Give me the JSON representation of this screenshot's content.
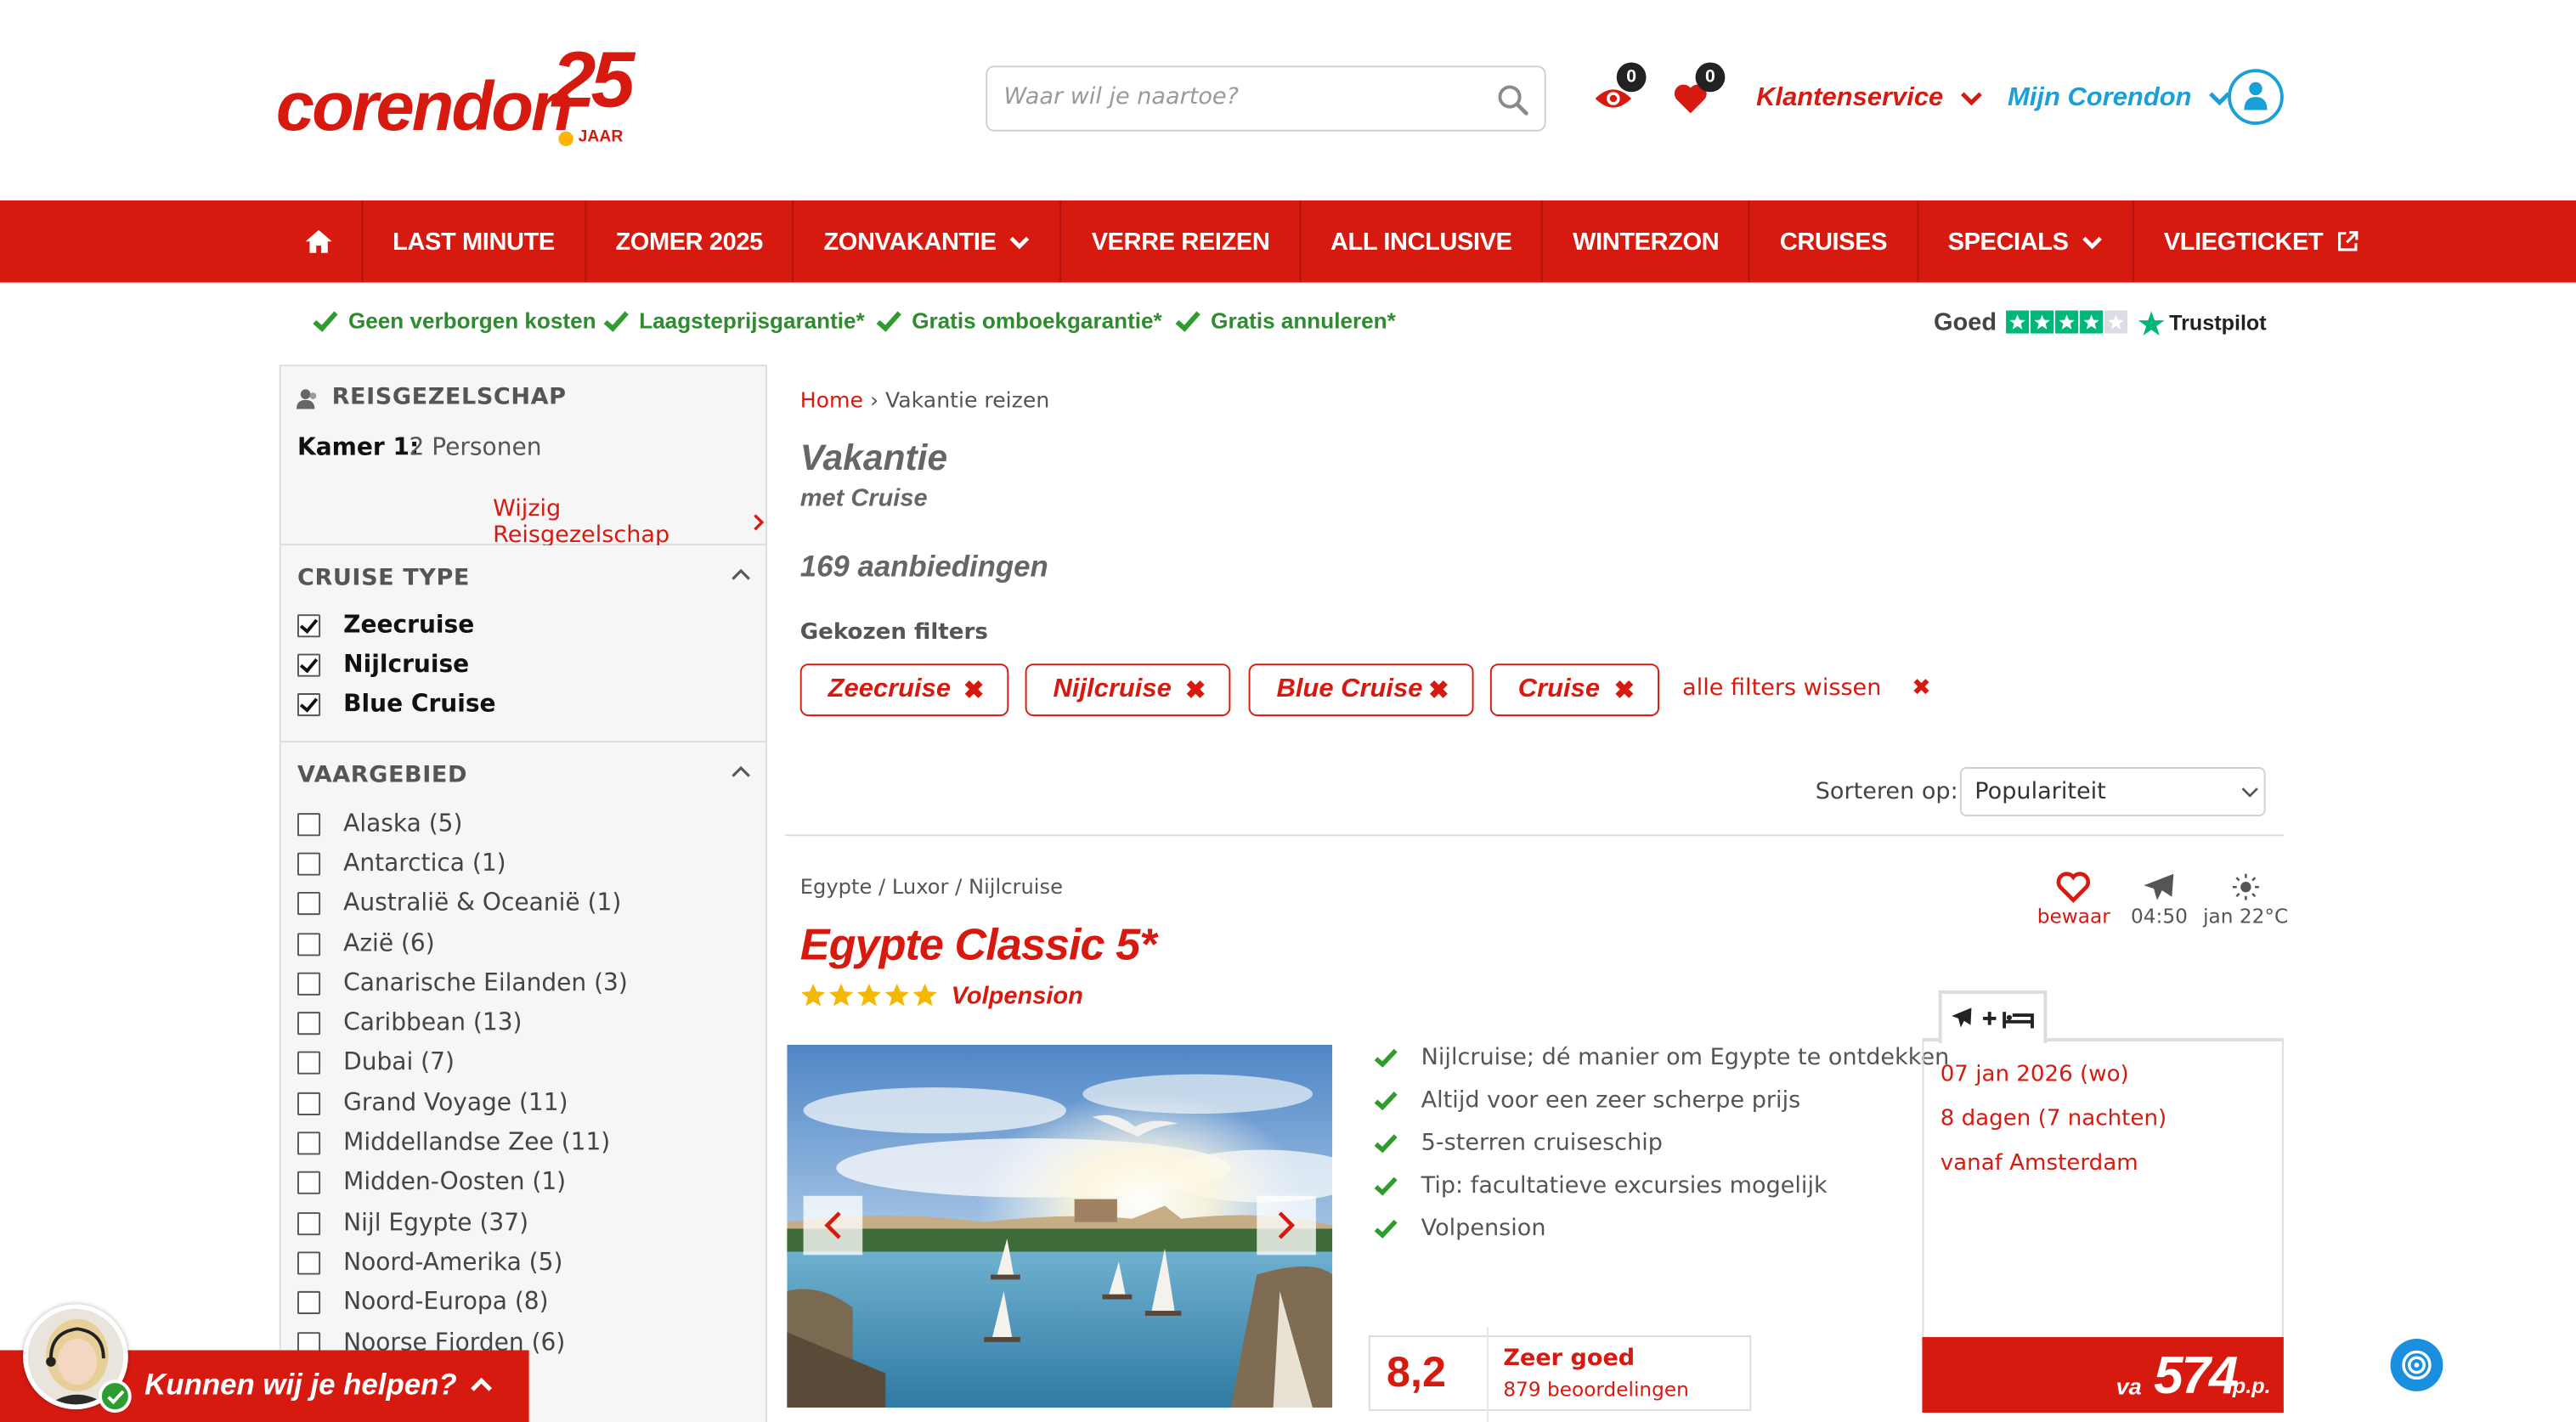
{
  "header": {
    "logo_text": "corendon",
    "logo_anniversary": "25",
    "logo_jaar": "JAAR",
    "search_placeholder": "Waar wil je naartoe?",
    "views_count": "0",
    "favorites_count": "0",
    "customer_service": "Klantenservice",
    "my_account": "Mijn Corendon"
  },
  "nav": {
    "items": [
      "LAST MINUTE",
      "ZOMER 2025",
      "ZONVAKANTIE",
      "VERRE REIZEN",
      "ALL INCLUSIVE",
      "WINTERZON",
      "CRUISES",
      "SPECIALS",
      "VLIEGTICKET"
    ]
  },
  "usp": {
    "items": [
      "Geen verborgen kosten",
      "Laagsteprijsgarantie*",
      "Gratis omboekgarantie*",
      "Gratis annuleren*"
    ],
    "trust_label": "Goed",
    "trust_brand": "Trustpilot",
    "trust_stars": 4
  },
  "sidebar": {
    "party_title": "REISGEZELSCHAP",
    "room_label": "Kamer 1:",
    "room_value": "2 Personen",
    "change_party": "Wijzig Reisgezelschap",
    "cruise_type_title": "CRUISE TYPE",
    "cruise_types": [
      {
        "label": "Zeecruise",
        "checked": true
      },
      {
        "label": "Nijlcruise",
        "checked": true
      },
      {
        "label": "Blue Cruise",
        "checked": true
      }
    ],
    "area_title": "VAARGEBIED",
    "areas": [
      "Alaska (5)",
      "Antarctica (1)",
      "Australië & Oceanië (1)",
      "Azië (6)",
      "Canarische Eilanden (3)",
      "Caribbean (13)",
      "Dubai (7)",
      "Grand Voyage (11)",
      "Middellandse Zee (11)",
      "Midden-Oosten (1)",
      "Nijl Egypte (37)",
      "Noord-Amerika (5)",
      "Noord-Europa (8)",
      "Noorse Fjorden (6)"
    ]
  },
  "main": {
    "breadcrumb_home": "Home",
    "breadcrumb_sep": "›",
    "breadcrumb_current": "Vakantie reizen",
    "title": "Vakantie",
    "subtitle": "met Cruise",
    "offer_count": "169 aanbiedingen",
    "chosen_filters_label": "Gekozen filters",
    "filters": [
      "Zeecruise",
      "Nijlcruise",
      "Blue Cruise",
      "Cruise"
    ],
    "clear_filters": "alle filters wissen",
    "sort_label": "Sorteren op:",
    "sort_value": "Populariteit"
  },
  "result": {
    "location": "Egypte / Luxor / Nijlcruise",
    "name": "Egypte Classic 5*",
    "stars": 5,
    "board": "Volpension",
    "save_label": "bewaar",
    "flight_time": "04:50",
    "weather": "jan 22°C",
    "features": [
      "Nijlcruise; dé manier om Egypte te ontdekken",
      "Altijd voor een zeer scherpe prijs",
      "5-sterren cruiseschip",
      "Tip: facultatieve excursies mogelijk",
      "Volpension"
    ],
    "rating_score": "8,2",
    "rating_label": "Zeer goed",
    "rating_count": "879 beoordelingen",
    "deal_tab": "✈+🛏",
    "deal_date": "07 jan 2026 (wo)",
    "deal_duration": "8 dagen (7 nachten)",
    "deal_departure": "vanaf Amsterdam",
    "price_prefix": "va",
    "price": "574",
    "price_suffix": "p.p."
  },
  "chat": {
    "label": "Kunnen wij je helpen?"
  },
  "colors": {
    "brand_red": "#d71a10",
    "usp_green": "#2e8b2e",
    "account_blue": "#1aa0d8",
    "trustpilot_green": "#00b67a"
  }
}
